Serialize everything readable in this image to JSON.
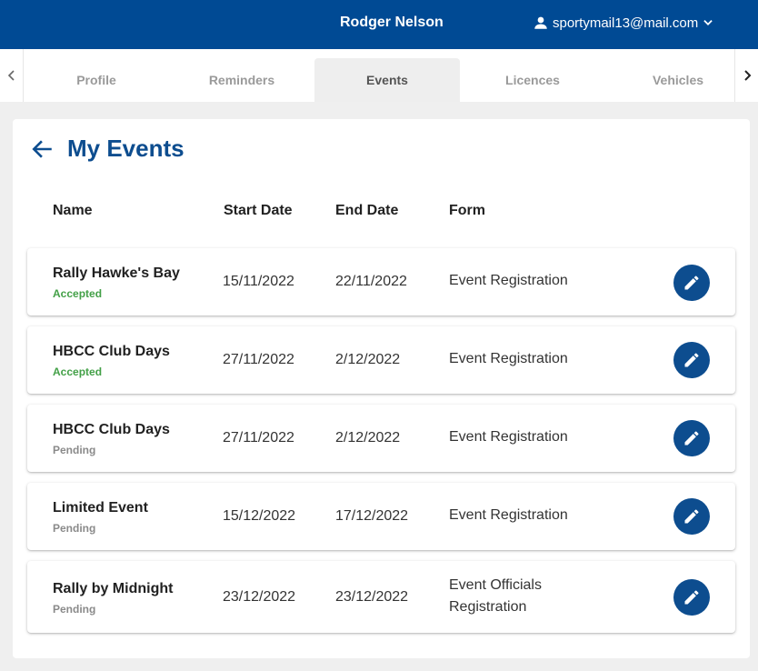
{
  "header": {
    "user_name": "Rodger Nelson",
    "account_email": "sportymail13@mail.com",
    "account_icon": "person-icon",
    "menu_icon": "chevron-down-icon",
    "bg_color": "#004a94"
  },
  "tabs": {
    "items": [
      {
        "label": "Profile",
        "active": false
      },
      {
        "label": "Reminders",
        "active": false
      },
      {
        "label": "Events",
        "active": true
      },
      {
        "label": "Licences",
        "active": false
      },
      {
        "label": "Vehicles",
        "active": false
      }
    ]
  },
  "page": {
    "title": "My Events",
    "back_icon": "arrow-left-icon"
  },
  "table": {
    "headers": {
      "name": "Name",
      "start_date": "Start Date",
      "end_date": "End Date",
      "form": "Form"
    },
    "rows": [
      {
        "name": "Rally Hawke's Bay",
        "status": "Accepted",
        "start": "15/11/2022",
        "end": "22/11/2022",
        "form": "Event Registration"
      },
      {
        "name": "HBCC Club Days",
        "status": "Accepted",
        "start": "27/11/2022",
        "end": "2/12/2022",
        "form": "Event Registration"
      },
      {
        "name": "HBCC Club Days",
        "status": "Pending",
        "start": "27/11/2022",
        "end": "2/12/2022",
        "form": "Event Registration"
      },
      {
        "name": "Limited Event",
        "status": "Pending",
        "start": "15/12/2022",
        "end": "17/12/2022",
        "form": "Event Registration"
      },
      {
        "name": "Rally by Midnight",
        "status": "Pending",
        "start": "23/12/2022",
        "end": "23/12/2022",
        "form": "Event Officials Registration"
      }
    ],
    "status_colors": {
      "Accepted": "#43a047",
      "Pending": "#8a8a8a"
    },
    "edit_icon": "pencil-icon",
    "accent": "#0d4d8f"
  }
}
